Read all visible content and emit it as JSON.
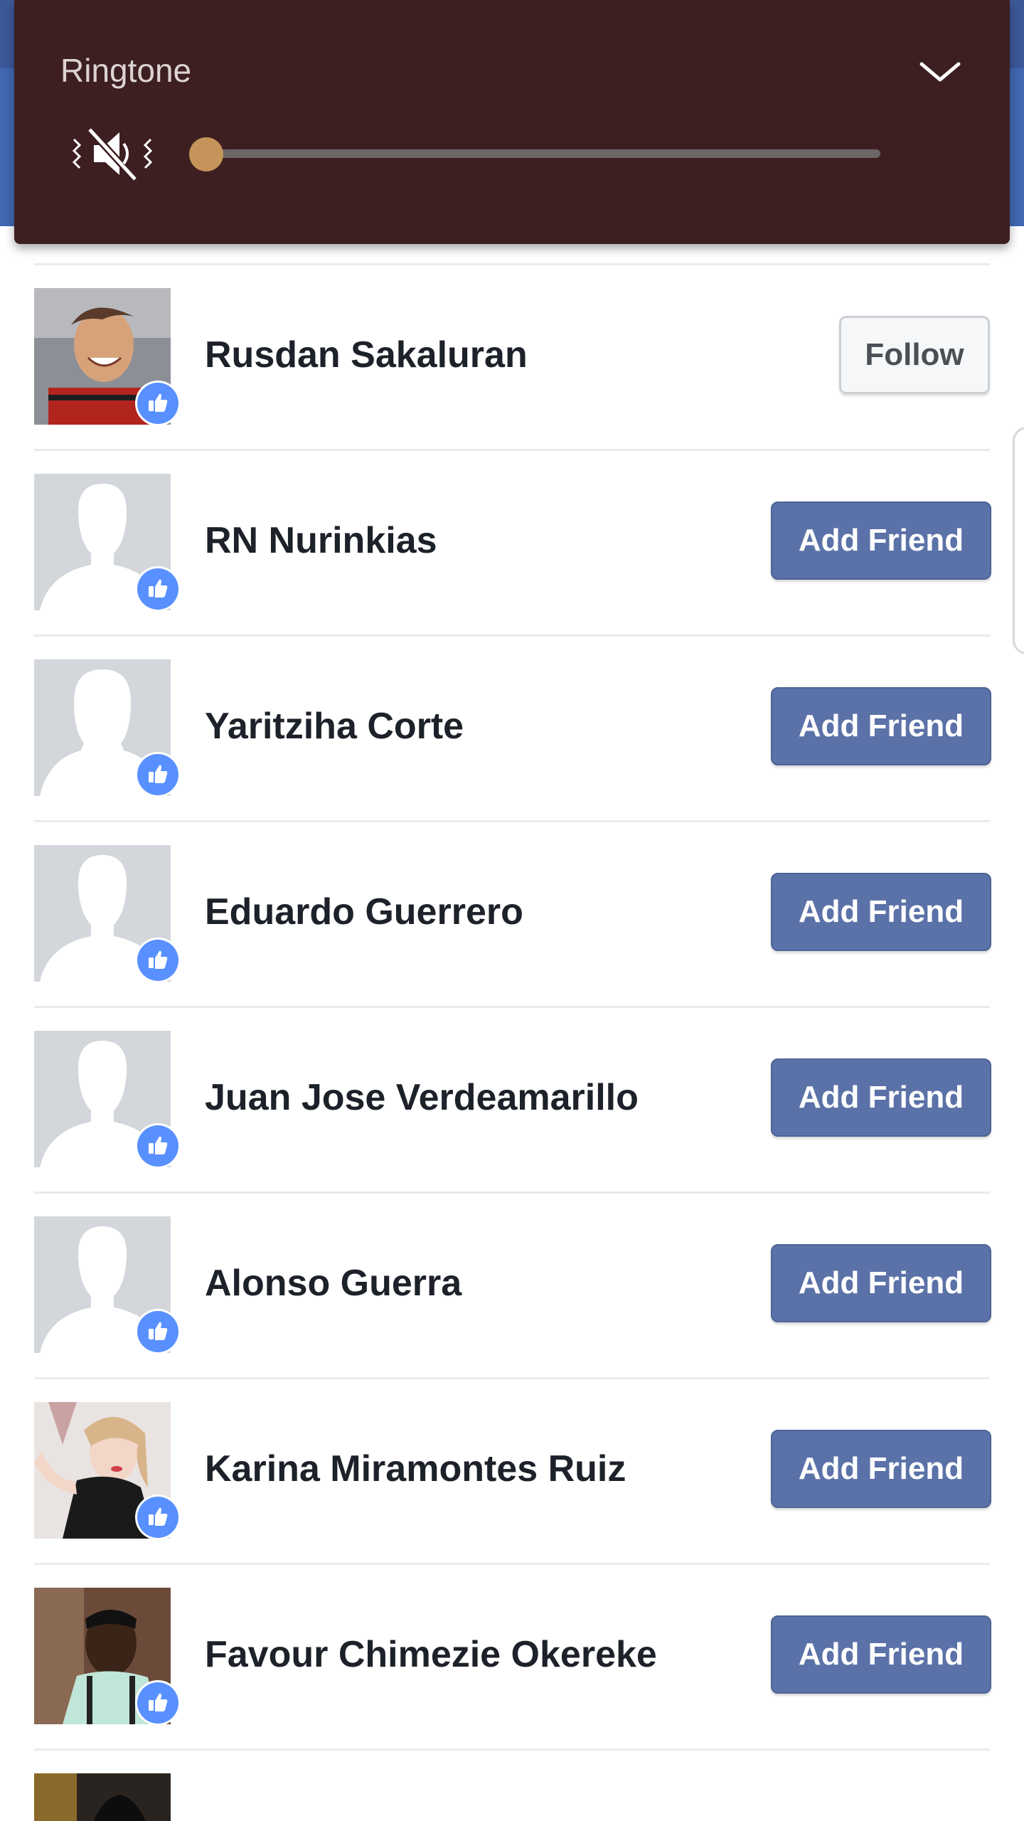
{
  "volume_panel": {
    "label": "Ringtone",
    "level": 0,
    "accent_color": "#c4945a",
    "panel_color": "#3d1f21",
    "mute_icon": "vibrate-mute-icon",
    "collapse_icon": "chevron-down-icon"
  },
  "friends": {
    "button_color": "#5b72a8",
    "badge_color": "#5890ff",
    "rows": [
      {
        "name": "Rusdan Sakaluran",
        "action": "Follow",
        "avatar": "photo-person"
      },
      {
        "name": "RN Nurinkias",
        "action": "Add Friend",
        "avatar": "default-male-silhouette"
      },
      {
        "name": "Yaritziha Corte",
        "action": "Add Friend",
        "avatar": "default-female-silhouette"
      },
      {
        "name": "Eduardo Guerrero",
        "action": "Add Friend",
        "avatar": "default-male-silhouette"
      },
      {
        "name": "Juan Jose Verdeamarillo",
        "action": "Add Friend",
        "avatar": "default-male-silhouette"
      },
      {
        "name": "Alonso Guerra",
        "action": "Add Friend",
        "avatar": "default-male-silhouette"
      },
      {
        "name": "Karina Miramontes Ruiz",
        "action": "Add Friend",
        "avatar": "photo-person"
      },
      {
        "name": "Favour Chimezie Okereke",
        "action": "Add Friend",
        "avatar": "photo-person"
      }
    ]
  }
}
